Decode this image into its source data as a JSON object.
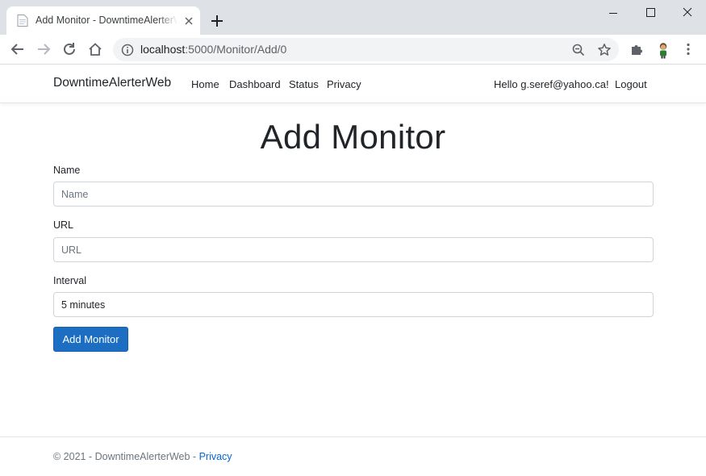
{
  "browser": {
    "tab_title": "Add Monitor - DowntimeAlerterWeb",
    "url_host": "localhost",
    "url_rest": ":5000/Monitor/Add/0"
  },
  "navbar": {
    "brand": "DowntimeAlerterWeb",
    "links": [
      "Home",
      "Dashboard",
      "Status",
      "Privacy"
    ],
    "greeting": "Hello g.seref@yahoo.ca!",
    "logout": "Logout"
  },
  "form": {
    "title": "Add Monitor",
    "name_label": "Name",
    "name_placeholder": "Name",
    "url_label": "URL",
    "url_placeholder": "URL",
    "interval_label": "Interval",
    "interval_value": "5 minutes",
    "submit_label": "Add Monitor"
  },
  "footer": {
    "copyright": "© 2021 - DowntimeAlerterWeb - ",
    "privacy_link": "Privacy"
  },
  "colors": {
    "primary_button": "#1b6ec2",
    "link": "#0366d6",
    "tabstrip": "#dee1e6"
  }
}
